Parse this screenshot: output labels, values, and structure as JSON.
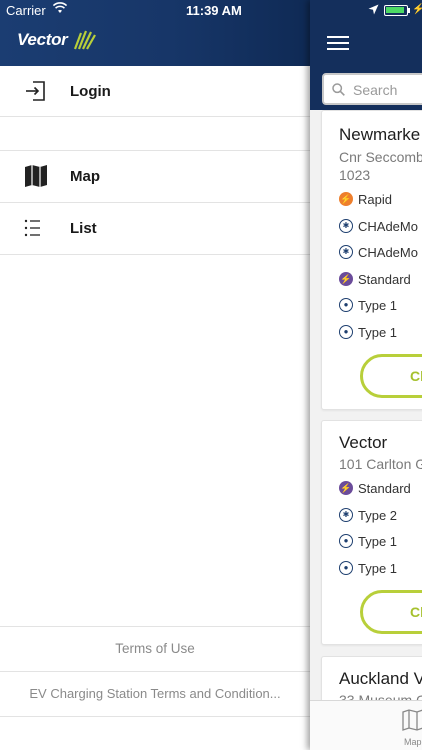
{
  "status_bar": {
    "carrier": "Carrier",
    "time": "11:39 AM"
  },
  "drawer": {
    "brand": "Vector",
    "login_label": "Login",
    "menu": [
      {
        "label": "Map",
        "icon": "map-icon"
      },
      {
        "label": "List",
        "icon": "list-icon"
      }
    ],
    "terms_of_use": "Terms of Use",
    "station_terms": "EV Charging Station Terms and Condition..."
  },
  "main": {
    "search_placeholder": "Search",
    "stations": [
      {
        "name": "Newmarke",
        "address_lines": [
          "Cnr Seccomb",
          "1023"
        ],
        "connectors": [
          {
            "label": "Rapid",
            "kind": "rapid-icon"
          },
          {
            "label": "CHAdeMo",
            "kind": "chademo-icon"
          },
          {
            "label": "CHAdeMo",
            "kind": "chademo-icon"
          },
          {
            "label": "Standard",
            "kind": "standard-icon"
          },
          {
            "label": "Type 1",
            "kind": "type1-icon"
          },
          {
            "label": "Type 1",
            "kind": "type1-icon"
          }
        ],
        "button_label": "Ch"
      },
      {
        "name": "Vector",
        "address_lines": [
          "101 Carlton G"
        ],
        "connectors": [
          {
            "label": "Standard",
            "kind": "standard-icon"
          },
          {
            "label": "Type 2",
            "kind": "type2-icon"
          },
          {
            "label": "Type 1",
            "kind": "type1-icon"
          },
          {
            "label": "Type 1",
            "kind": "type1-icon"
          }
        ],
        "button_label": "Ch"
      },
      {
        "name": "Auckland V",
        "address_lines": [
          "33 Museum C"
        ]
      }
    ],
    "tab_map_label": "Map"
  },
  "colors": {
    "header_blue": "#173668",
    "accent_green": "#b8cf3a",
    "rapid_orange": "#ee7f2d",
    "standard_purple": "#6b4c9a"
  }
}
